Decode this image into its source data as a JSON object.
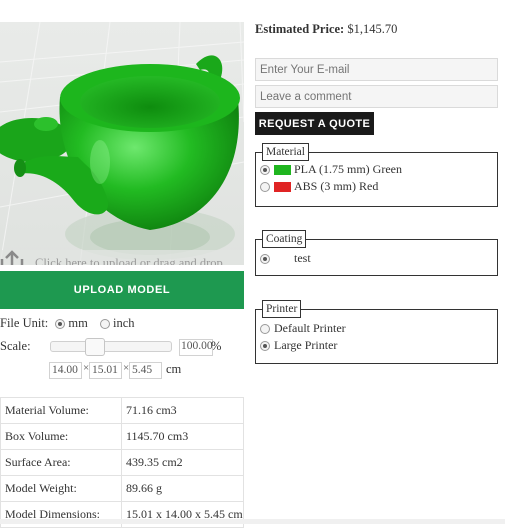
{
  "viewer": {
    "upload_hint": "Click here to upload or drag and drop your model to the canvas.",
    "model_color": "#1fb51f"
  },
  "upload": {
    "button_label": "UPLOAD MODEL"
  },
  "file_unit": {
    "label": "File Unit:",
    "options": [
      {
        "label": "mm",
        "selected": true
      },
      {
        "label": "inch",
        "selected": false
      }
    ]
  },
  "scale": {
    "label": "Scale:",
    "value": "100.00",
    "suffix": "%"
  },
  "dimensions": {
    "x": "14.00",
    "y": "15.01",
    "z": "5.45",
    "separator": "×",
    "unit": "cm"
  },
  "stats": [
    {
      "label": "Material Volume:",
      "value": "71.16 cm3"
    },
    {
      "label": "Box Volume:",
      "value": "1145.70 cm3"
    },
    {
      "label": "Surface Area:",
      "value": "439.35 cm2"
    },
    {
      "label": "Model Weight:",
      "value": "89.66 g"
    },
    {
      "label": "Model Dimensions:",
      "value": "15.01 x 14.00 x 5.45 cm"
    }
  ],
  "price": {
    "label": "Estimated Price:",
    "value": "$1,145.70"
  },
  "quote_form": {
    "email_placeholder": "Enter Your E-mail",
    "comment_placeholder": "Leave a comment",
    "submit_label": "REQUEST A QUOTE"
  },
  "material": {
    "legend": "Material",
    "options": [
      {
        "label": "PLA (1.75 mm) Green",
        "color": "#1fb51f",
        "selected": true
      },
      {
        "label": "ABS (3 mm) Red",
        "color": "#e02424",
        "selected": false
      }
    ]
  },
  "coating": {
    "legend": "Coating",
    "options": [
      {
        "label": "test",
        "selected": true
      }
    ]
  },
  "printer": {
    "legend": "Printer",
    "options": [
      {
        "label": "Default Printer",
        "selected": false
      },
      {
        "label": "Large Printer",
        "selected": true
      }
    ]
  }
}
